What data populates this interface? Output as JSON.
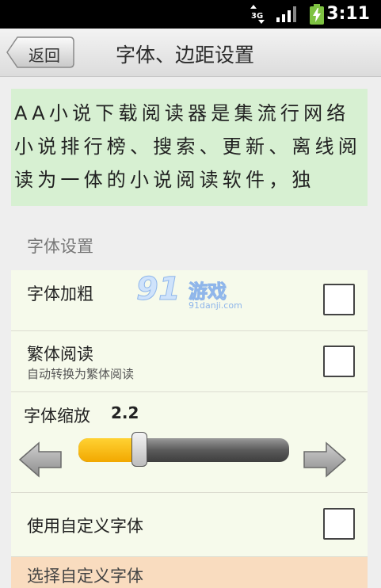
{
  "status_bar": {
    "network": "3G",
    "time": "3:11",
    "icons": [
      "3g-data-icon",
      "signal-icon",
      "battery-charging-icon"
    ]
  },
  "title_bar": {
    "back_label": "返回",
    "title": "字体、边距设置"
  },
  "preview": {
    "text": "AA小说下载阅读器是集流行网络小说排行榜、搜索、更新、离线阅读为一体的小说阅读软件，独"
  },
  "font_settings": {
    "header": "字体设置",
    "bold": {
      "label": "字体加粗",
      "checked": false
    },
    "traditional": {
      "label": "繁体阅读",
      "sublabel": "自动转换为繁体阅读",
      "checked": false
    },
    "scale": {
      "label": "字体缩放",
      "value": "2.2",
      "slider_fraction": 0.25
    },
    "custom_font": {
      "label": "使用自定义字体",
      "checked": false
    },
    "choose_font": {
      "label": "选择自定义字体"
    }
  },
  "watermark": {
    "logo": "91",
    "text": "游戏",
    "domain": "91danji.com"
  },
  "colors": {
    "preview_bg": "#d7f0d2",
    "row_bg": "#f6faeb",
    "choose_bg": "#f9dcbf",
    "slider_fill": "#f5b300"
  }
}
